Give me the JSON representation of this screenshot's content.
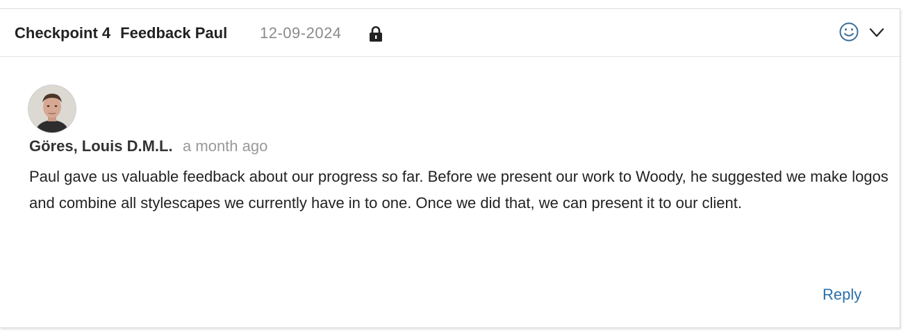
{
  "header": {
    "checkpoint": "Checkpoint 4",
    "title": "Feedback Paul",
    "date": "12-09-2024",
    "lock_icon": "lock-icon",
    "reaction_icon": "smiley-icon",
    "collapse_icon": "chevron-down-icon"
  },
  "comment": {
    "author": "Göres, Louis D.M.L.",
    "timestamp": "a month ago",
    "avatar_icon": "avatar",
    "message": "Paul gave us valuable feedback about our progress so far. Before we present our work to Woody, he suggested we make logos and combine all stylescapes we currently have in to one. Once we did that, we can present it to our client."
  },
  "actions": {
    "reply_label": "Reply"
  },
  "colors": {
    "link": "#2a6fa8",
    "icon": "#3a6d96",
    "muted": "#8a8a8a"
  }
}
